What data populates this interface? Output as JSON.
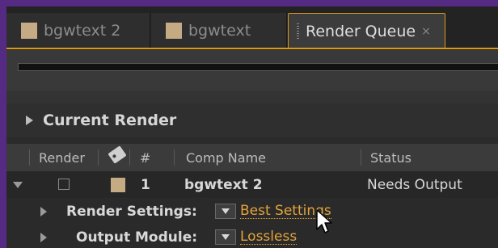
{
  "tabs": [
    {
      "label": "bgwtext 2",
      "swatch_color": "#c5ab84"
    },
    {
      "label": "bgwtext",
      "swatch_color": "#c5ab84"
    },
    {
      "label": "Render Queue",
      "close_glyph": "×",
      "active": true
    }
  ],
  "accent_color": "#d99a1c",
  "current_render": {
    "label": "Current Render"
  },
  "columns": {
    "render": "Render",
    "tag_icon": "tag-icon",
    "number": "#",
    "comp_name": "Comp Name",
    "status": "Status"
  },
  "queue_item": {
    "number": "1",
    "comp_name": "bgwtext 2",
    "status": "Needs Output",
    "label_color": "#c5ab84",
    "render_checked": false
  },
  "render_settings": {
    "label": "Render Settings:",
    "value": "Best Settings"
  },
  "output_module": {
    "label": "Output Module:",
    "value": "Lossless"
  }
}
